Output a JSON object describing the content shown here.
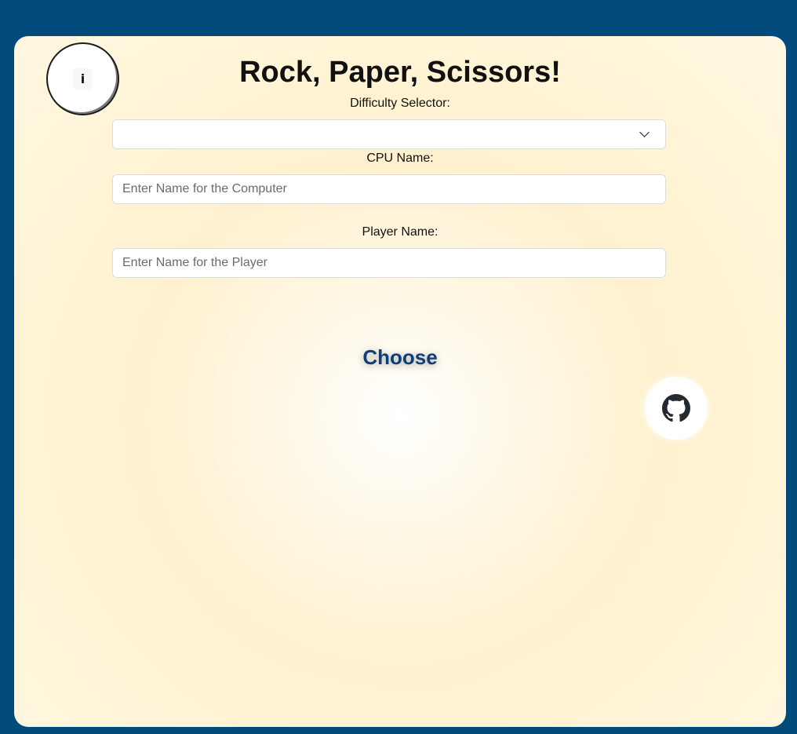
{
  "info_button": {
    "label": "i"
  },
  "title": "Rock, Paper, Scissors!",
  "difficulty": {
    "label": "Difficulty Selector:",
    "selected": ""
  },
  "cpu": {
    "label": "CPU Name:",
    "placeholder": "Enter Name for the Computer",
    "value": ""
  },
  "player": {
    "label": "Player Name:",
    "placeholder": "Enter Name for the Player",
    "value": ""
  },
  "choose_label": "Choose",
  "icons": {
    "info": "info-icon",
    "dropdown": "chevron-down-icon",
    "github": "github-icon"
  },
  "colors": {
    "page_background": "#004a7c",
    "card_background": "#fff4d6",
    "choose_text": "#0f3f78"
  }
}
